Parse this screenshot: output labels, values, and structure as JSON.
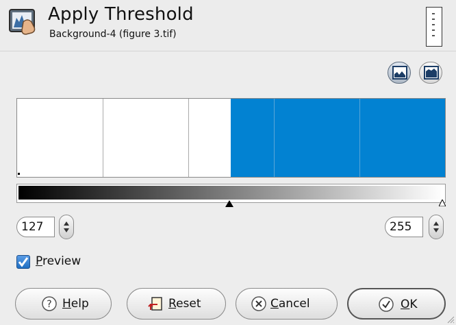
{
  "dialog": {
    "title": "Apply Threshold",
    "subtitle": "Background-4 (figure 3.tif)",
    "app_icon": "threshold-tool-icon",
    "thumbnail": "image-thumbnail"
  },
  "histogram": {
    "mode_buttons": [
      {
        "icon": "linear-histogram-icon",
        "active": true
      },
      {
        "icon": "logarithmic-histogram-icon",
        "active": false
      }
    ],
    "threshold_color": "#0282d2"
  },
  "range": {
    "low": "127",
    "high": "255"
  },
  "preview": {
    "label_mnemonic": "P",
    "label_rest": "review",
    "checked": true
  },
  "buttons": {
    "help": {
      "mnemonic": "H",
      "rest": "elp",
      "icon": "question-icon"
    },
    "reset": {
      "mnemonic": "R",
      "rest": "eset",
      "icon": "reset-icon"
    },
    "cancel": {
      "mnemonic": "C",
      "rest": "ancel",
      "icon": "cancel-icon"
    },
    "ok": {
      "mnemonic": "O",
      "rest": "K",
      "icon": "checkmark-icon"
    }
  }
}
